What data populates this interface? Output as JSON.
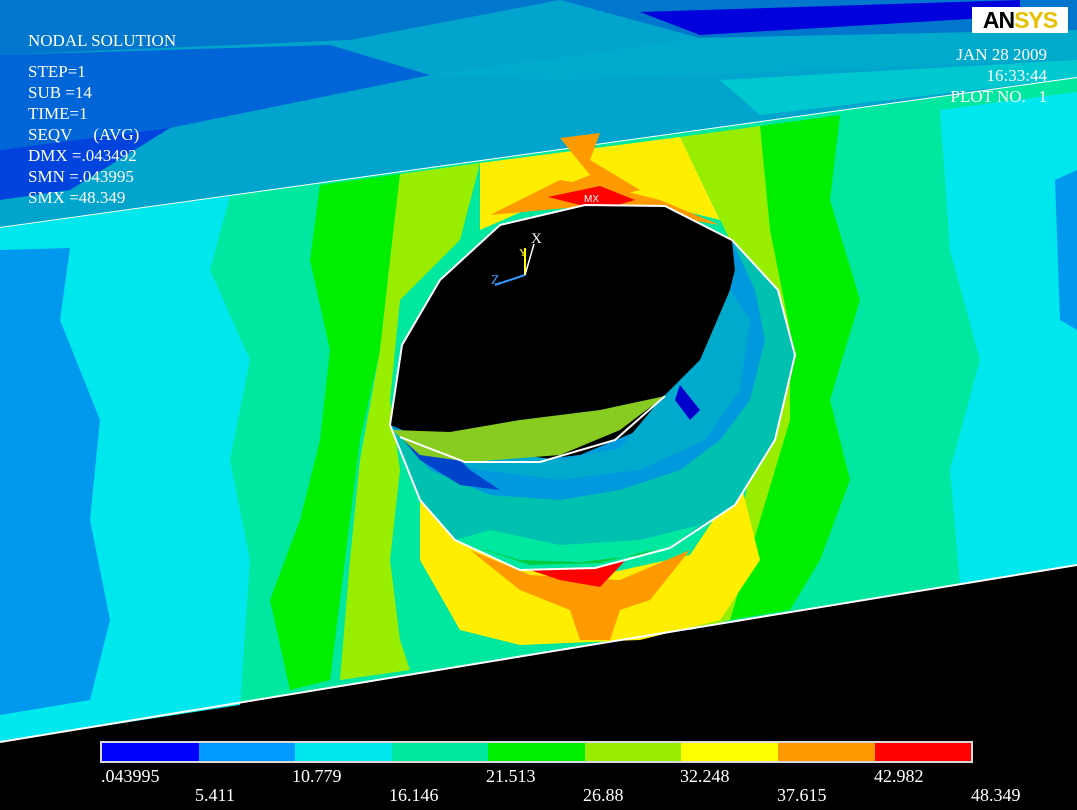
{
  "app": {
    "logo_left": "AN",
    "logo_right": "SYS"
  },
  "info": {
    "title": "NODAL SOLUTION",
    "step": "STEP=1",
    "sub": "SUB =14",
    "time": "TIME=1",
    "seqv": "SEQV     (AVG)",
    "dmx": "DMX =.043492",
    "smn": "SMN =.043995",
    "smx": "SMX =48.349"
  },
  "stamp": {
    "date": "JAN 28 2009",
    "time": "16:33:44",
    "plot": "PLOT NO.   1"
  },
  "markers": {
    "mx": "MX"
  },
  "triad": {
    "x": "X",
    "y": "Y",
    "z": "Z"
  },
  "legend": {
    "colors": [
      "#0000ff",
      "#0099ff",
      "#00e8ee",
      "#00e8a0",
      "#00ee00",
      "#99ee00",
      "#ffff00",
      "#ff9900",
      "#ff0000"
    ],
    "labels": [
      ".043995",
      "5.411",
      "10.779",
      "16.146",
      "21.513",
      "26.88",
      "32.248",
      "37.615",
      "42.982",
      "48.349"
    ]
  }
}
